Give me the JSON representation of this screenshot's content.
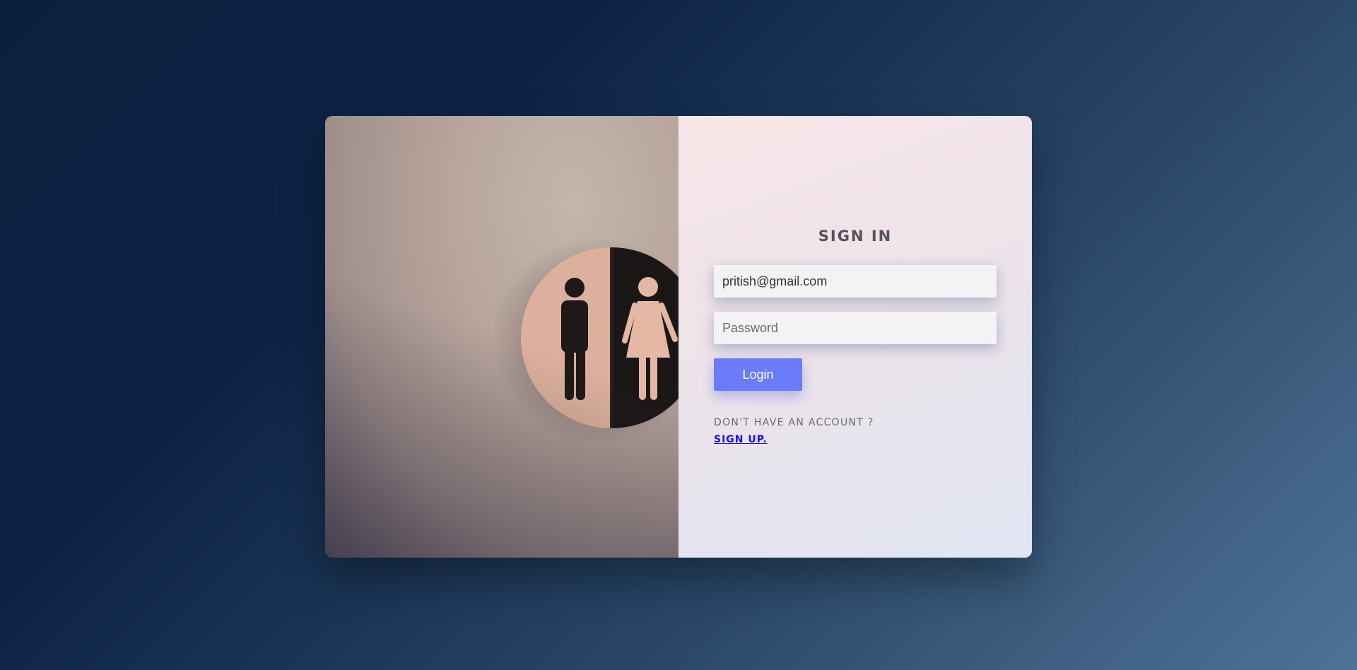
{
  "form": {
    "title": "SIGN IN",
    "email_value": "pritish@gmail.com",
    "password_placeholder": "Password",
    "login_label": "Login",
    "no_account_text": "DON'T HAVE AN ACCOUNT ?",
    "signup_link": "SIGN UP."
  },
  "colors": {
    "accent": "#6a7cf8",
    "link": "#1a14d6"
  },
  "image": {
    "subject": "restroom-sign-icon"
  }
}
